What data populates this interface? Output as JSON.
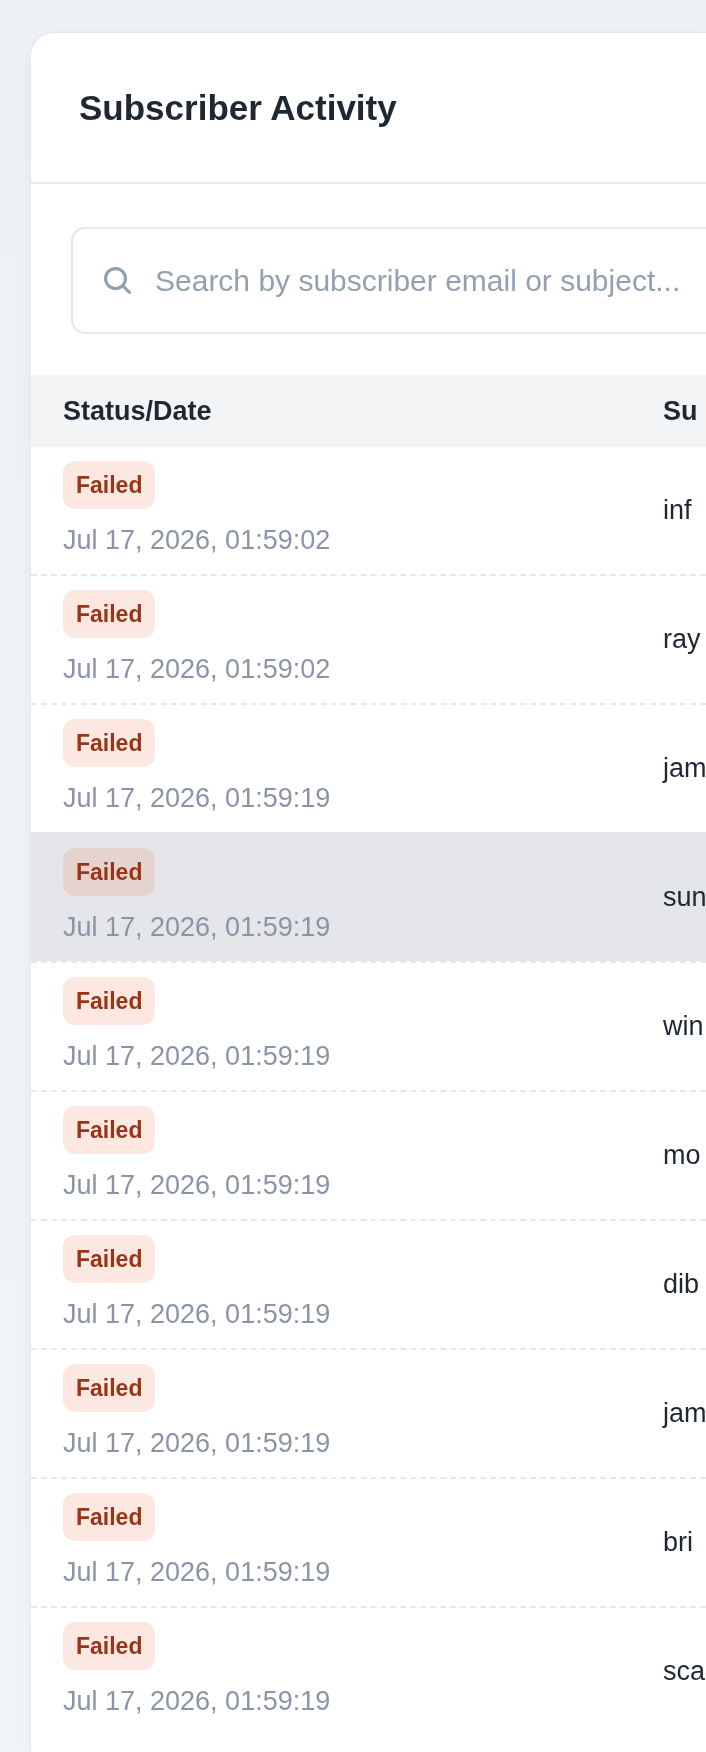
{
  "card": {
    "title": "Subscriber Activity"
  },
  "search": {
    "placeholder": "Search by subscriber email or subject..."
  },
  "table": {
    "columns": [
      "Status/Date",
      "Su"
    ],
    "rows": [
      {
        "status": "Failed",
        "date": "Jul 17, 2026, 01:59:02",
        "column_2": "inf",
        "highlighted": false
      },
      {
        "status": "Failed",
        "date": "Jul 17, 2026, 01:59:02",
        "column_2": "ray",
        "highlighted": false
      },
      {
        "status": "Failed",
        "date": "Jul 17, 2026, 01:59:19",
        "column_2": "jam",
        "highlighted": false
      },
      {
        "status": "Failed",
        "date": "Jul 17, 2026, 01:59:19",
        "column_2": "sun",
        "highlighted": true
      },
      {
        "status": "Failed",
        "date": "Jul 17, 2026, 01:59:19",
        "column_2": "win",
        "highlighted": false
      },
      {
        "status": "Failed",
        "date": "Jul 17, 2026, 01:59:19",
        "column_2": "mo",
        "highlighted": false
      },
      {
        "status": "Failed",
        "date": "Jul 17, 2026, 01:59:19",
        "column_2": "dib",
        "highlighted": false
      },
      {
        "status": "Failed",
        "date": "Jul 17, 2026, 01:59:19",
        "column_2": "jam",
        "highlighted": false
      },
      {
        "status": "Failed",
        "date": "Jul 17, 2026, 01:59:19",
        "column_2": "bri",
        "highlighted": false
      },
      {
        "status": "Failed",
        "date": "Jul 17, 2026, 01:59:19",
        "column_2": "sca",
        "highlighted": false
      }
    ]
  }
}
